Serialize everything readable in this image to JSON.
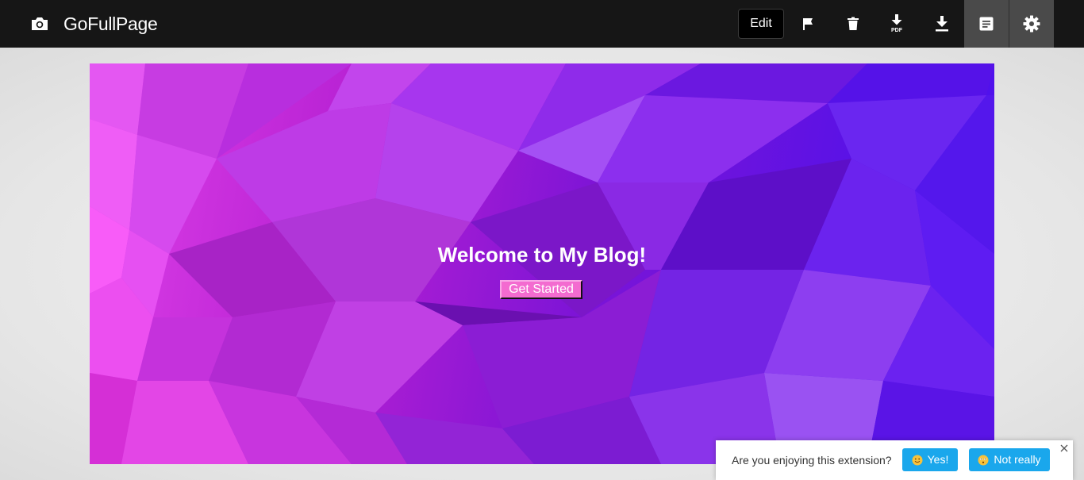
{
  "app": {
    "title": "GoFullPage",
    "icons": {
      "brand": "camera-icon"
    }
  },
  "toolbar": {
    "edit_label": "Edit",
    "pdf_label": "PDF",
    "tools": [
      {
        "name": "flag-icon",
        "active": false
      },
      {
        "name": "trash-icon",
        "active": false
      },
      {
        "name": "download-pdf-icon",
        "active": false
      },
      {
        "name": "download-icon",
        "active": false
      },
      {
        "name": "document-icon",
        "active": true
      },
      {
        "name": "gear-icon",
        "active": true
      }
    ]
  },
  "screenshot": {
    "hero_title": "Welcome to My Blog!",
    "cta_label": "Get Started",
    "colors": {
      "button_bg": "#f36bd0",
      "gradient_left": "#e041e8",
      "gradient_right": "#4b10f0"
    }
  },
  "feedback": {
    "question": "Are you enjoying this extension?",
    "yes_label": "Yes!",
    "no_label": "Not really",
    "accent": "#1aa7ec"
  }
}
